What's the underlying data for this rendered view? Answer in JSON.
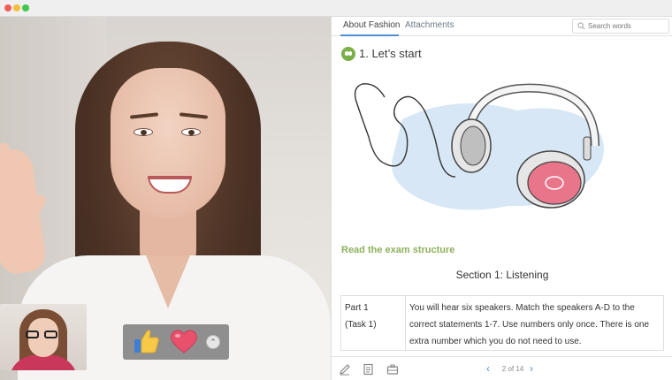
{
  "window": {
    "controls": [
      "close",
      "minimize",
      "maximize"
    ]
  },
  "video": {
    "reactions": {
      "thumb_icon": "thumbs-up-icon",
      "heart_icon": "heart-icon",
      "more_icon": "chevron-up-icon",
      "more_glyph": "⌃"
    }
  },
  "panel": {
    "tabs": [
      {
        "label": "About Fashion",
        "active": true
      },
      {
        "label": "Attachments",
        "active": false
      }
    ],
    "search": {
      "placeholder": "Search words"
    },
    "section": {
      "title": "1. Let’s start",
      "icon": "headphones-badge-icon"
    },
    "instruction": "Read the exam structure",
    "subsection": "Section 1: Listening",
    "table": {
      "rows": [
        {
          "part": "Part 1",
          "task": "(Task 1)",
          "description": "You will hear six speakers. Match the speakers A-D to the correct statements 1-7. Use numbers only once. There is one extra number which you do not need to use."
        }
      ]
    },
    "footer": {
      "tools": [
        "pencil-icon",
        "notes-icon",
        "briefcase-icon"
      ],
      "page_label": "2 of 14"
    }
  },
  "colors": {
    "accent": "#4e8fd3",
    "green": "#8db05c",
    "heart": "#e8506b"
  }
}
